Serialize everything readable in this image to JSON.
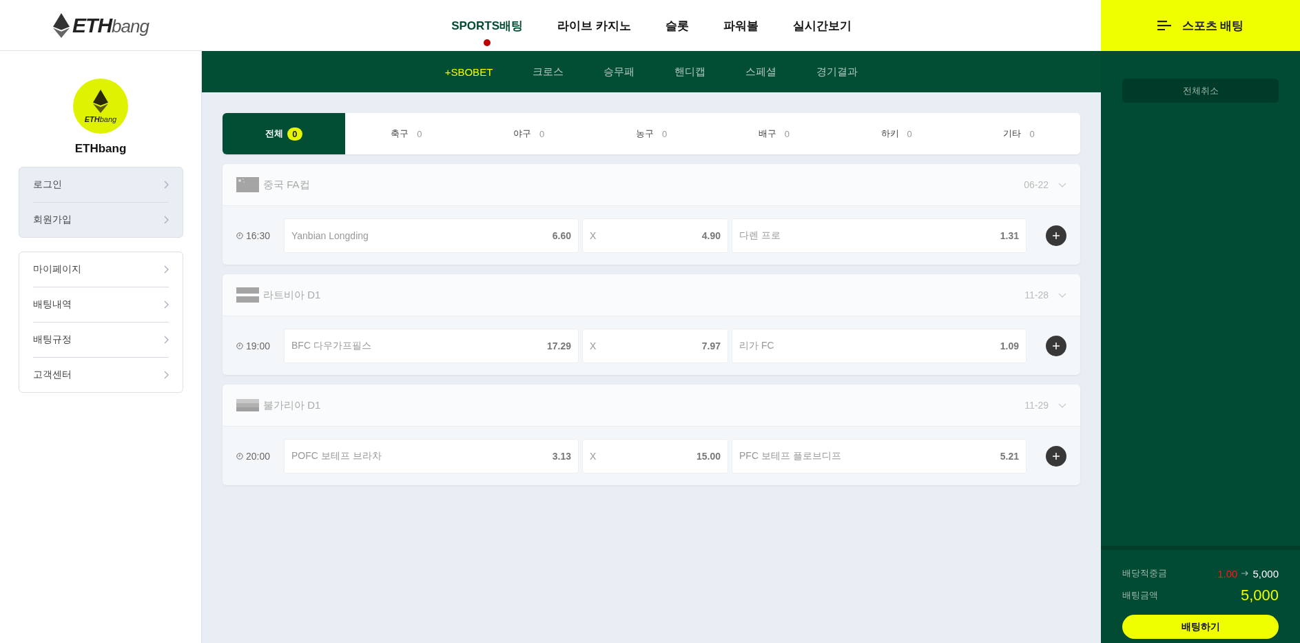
{
  "logo": {
    "bold": "ETH",
    "light": "bang"
  },
  "main_nav": [
    {
      "label": "SPORTS배팅",
      "selected": true
    },
    {
      "label": "라이브 카지노",
      "selected": false
    },
    {
      "label": "슬롯",
      "selected": false
    },
    {
      "label": "파워볼",
      "selected": false
    },
    {
      "label": "실시간보기",
      "selected": false
    }
  ],
  "betslip_header": {
    "title": "스포츠 배팅"
  },
  "sub_nav": [
    {
      "label": "+SBOBET",
      "selected": true
    },
    {
      "label": "크로스",
      "selected": false
    },
    {
      "label": "승무패",
      "selected": false
    },
    {
      "label": "핸디캡",
      "selected": false
    },
    {
      "label": "스페셜",
      "selected": false
    },
    {
      "label": "경기결과",
      "selected": false
    }
  ],
  "profile": {
    "logo_bold": "ETH",
    "logo_light": "bang",
    "name": "ETHbang"
  },
  "auth_menu": [
    "로그인",
    "회원가입"
  ],
  "user_menu": [
    "마이페이지",
    "배팅내역",
    "배팅규정",
    "고객센터"
  ],
  "sport_tabs": [
    {
      "label": "전체",
      "count": "0",
      "selected": true
    },
    {
      "label": "축구",
      "count": "0",
      "selected": false
    },
    {
      "label": "야구",
      "count": "0",
      "selected": false
    },
    {
      "label": "농구",
      "count": "0",
      "selected": false
    },
    {
      "label": "배구",
      "count": "0",
      "selected": false
    },
    {
      "label": "하키",
      "count": "0",
      "selected": false
    },
    {
      "label": "기타",
      "count": "0",
      "selected": false
    }
  ],
  "leagues": [
    {
      "flag": {
        "kind": "stars"
      },
      "name": "중국 FA컵",
      "date": "06-22",
      "time": "16:30",
      "odds": [
        {
          "label": "Yanbian Longding",
          "value": "6.60"
        },
        {
          "label": "X",
          "value": "4.90"
        },
        {
          "label": "다렌 프로",
          "value": "1.31"
        }
      ]
    },
    {
      "flag": {
        "kind": "two-band"
      },
      "name": "라트비아 D1",
      "date": "11-28",
      "time": "19:00",
      "odds": [
        {
          "label": "BFC 다우가프필스",
          "value": "17.29"
        },
        {
          "label": "X",
          "value": "7.97"
        },
        {
          "label": "리가 FC",
          "value": "1.09"
        }
      ]
    },
    {
      "flag": {
        "kind": "three-band"
      },
      "name": "불가리아 D1",
      "date": "11-29",
      "time": "20:00",
      "odds": [
        {
          "label": "POFC 보테프 브라차",
          "value": "3.13"
        },
        {
          "label": "X",
          "value": "15.00"
        },
        {
          "label": "PFC 보테프 플로브디프",
          "value": "5.21"
        }
      ]
    }
  ],
  "betslip": {
    "clear_button": "전체취소",
    "payout_label": "배당적중금",
    "odds": "1.00",
    "payout": "5,000",
    "stake_label": "배팅금액",
    "stake": "5,000",
    "submit_button": "배팅하기"
  }
}
